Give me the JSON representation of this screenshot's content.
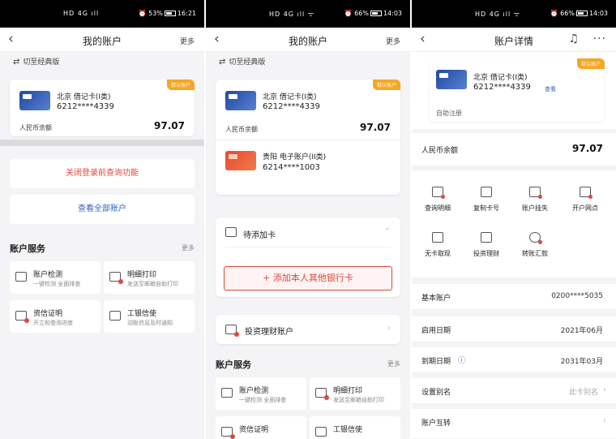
{
  "status": [
    {
      "left": "HD 4G ıll",
      "right": "53%",
      "time": "16:21"
    },
    {
      "left": "HD 4G ıll ᯤ",
      "right": "66%",
      "time": "14:03"
    },
    {
      "left": "HD 4G ıll ᯤ",
      "right": "66%",
      "time": "14:03"
    }
  ],
  "s1": {
    "title": "我的账户",
    "more": "更多",
    "switch": "切至经典版",
    "card": {
      "badge": "默认账户",
      "name": "北京 借记卡(I类)",
      "number": "6212****4339",
      "bal_label": "人民币余额",
      "balance": "97.07"
    },
    "close_login": "关闭登录前查询功能",
    "view_all": "查看全部账户",
    "services_title": "账户服务",
    "services_more": "更多",
    "services": [
      {
        "title": "账户检测",
        "sub": "一键检测 全面排查"
      },
      {
        "title": "明细打印",
        "sub": "发送至邮箱自助打印"
      },
      {
        "title": "资信证明",
        "sub": "开立和查询进度"
      },
      {
        "title": "工银信使",
        "sub": "动账信息及时通知"
      }
    ]
  },
  "s2": {
    "title": "我的账户",
    "more": "更多",
    "switch": "切至经典版",
    "card": {
      "badge": "默认账户",
      "name": "北京 借记卡(I类)",
      "number": "6212****4339",
      "bal_label": "人民币余额",
      "balance": "97.07"
    },
    "card2": {
      "name": "贵阳 电子账户(II类)",
      "number": "6214****1003"
    },
    "pending": "待添加卡",
    "add_card": "+ 添加本人其他银行卡",
    "invest": "投资理财账户",
    "services_title": "账户服务",
    "services_more": "更多",
    "services": [
      {
        "title": "账户检测",
        "sub": "一键检测 全面排查"
      },
      {
        "title": "明细打印",
        "sub": "发送至邮箱自助打印"
      },
      {
        "title": "资信证明",
        "sub": ""
      },
      {
        "title": "工银信使",
        "sub": ""
      }
    ]
  },
  "s3": {
    "title": "账户详情",
    "card": {
      "badge": "默认账户",
      "name": "北京 借记卡(I类)",
      "number": "6212****4339",
      "view": "查看",
      "reg": "自助注册"
    },
    "bal_label": "人民币余额",
    "balance": "97.07",
    "grid": [
      "查询明细",
      "复制卡号",
      "账户挂失",
      "开户网点",
      "无卡取现",
      "投资理财",
      "转账汇款"
    ],
    "rows": [
      {
        "label": "基本账户",
        "value": "0200****5035"
      },
      {
        "label": "启用日期",
        "value": "2021年06月"
      },
      {
        "label": "到期日期",
        "value": "2031年03月"
      },
      {
        "label": "设置别名",
        "value": "此卡别名"
      },
      {
        "label": "账户互转",
        "value": ""
      }
    ]
  }
}
